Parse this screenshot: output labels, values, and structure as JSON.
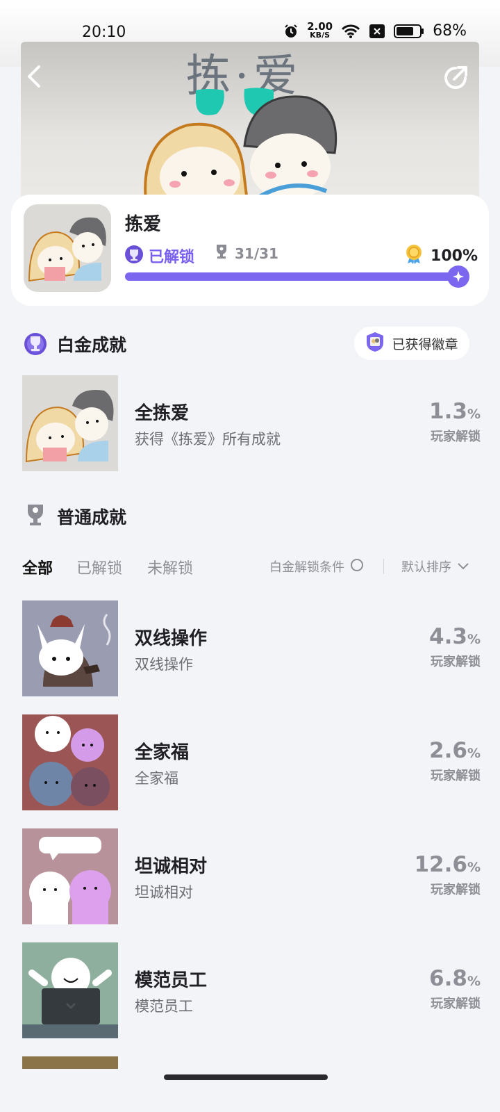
{
  "status_bar": {
    "time": "20:10",
    "net_speed_value": "2.00",
    "net_speed_unit": "KB/S",
    "battery_percent": "68%"
  },
  "hero": {
    "title_art": "拣·爱"
  },
  "game": {
    "title": "拣爱",
    "unlock_state": "已解锁",
    "trophy_count": "31/31",
    "completion": "100%",
    "progress": 1.0
  },
  "platinum_section": {
    "title": "白金成就",
    "badge_button": "已获得徽章",
    "item": {
      "name": "全拣爱",
      "desc": "获得《拣爱》所有成就",
      "rate": "1.3",
      "rate_unit": "%",
      "rate_label": "玩家解锁"
    }
  },
  "normal_section": {
    "title": "普通成就",
    "tabs": [
      "全部",
      "已解锁",
      "未解锁"
    ],
    "active_tab": "全部",
    "condition_label": "白金解锁条件",
    "sort_label": "默认排序",
    "items": [
      {
        "name": "双线操作",
        "desc": "双线操作",
        "rate": "4.3",
        "rate_unit": "%",
        "rate_label": "玩家解锁"
      },
      {
        "name": "全家福",
        "desc": "全家福",
        "rate": "2.6",
        "rate_unit": "%",
        "rate_label": "玩家解锁"
      },
      {
        "name": "坦诚相对",
        "desc": "坦诚相对",
        "rate": "12.6",
        "rate_unit": "%",
        "rate_label": "玩家解锁"
      },
      {
        "name": "模范员工",
        "desc": "模范员工",
        "rate": "6.8",
        "rate_unit": "%",
        "rate_label": "玩家解锁"
      }
    ]
  },
  "colors": {
    "accent": "#7b66f0",
    "teal": "#1fc8b0",
    "muted": "#8e8f96"
  }
}
